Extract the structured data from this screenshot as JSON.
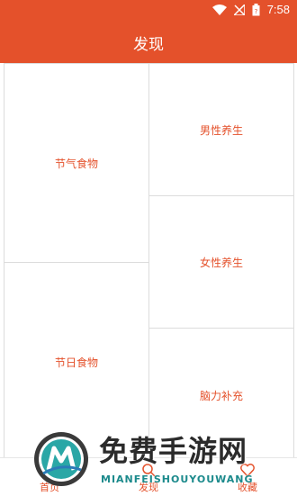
{
  "status_bar": {
    "time": "7:58",
    "icons": [
      "wifi-icon",
      "no-signal-icon",
      "battery-icon"
    ]
  },
  "header": {
    "title": "发现"
  },
  "cards": {
    "left_top": "节气食物",
    "left_bottom": "节日食物",
    "right_1": "男性养生",
    "right_2": "女性养生",
    "right_3": "脑力补充"
  },
  "bottom_nav": {
    "home": "首页",
    "discover": "发现",
    "favorites": "收藏",
    "icons": [
      "home-icon",
      "search-icon",
      "heart-icon"
    ]
  },
  "watermark": {
    "title": "免费手游网",
    "subtitle": "MIANFEISHOUYOUWANG"
  },
  "colors": {
    "accent": "#e4512b",
    "card_border": "#dcdcdc",
    "background": "#f2f2f2"
  }
}
